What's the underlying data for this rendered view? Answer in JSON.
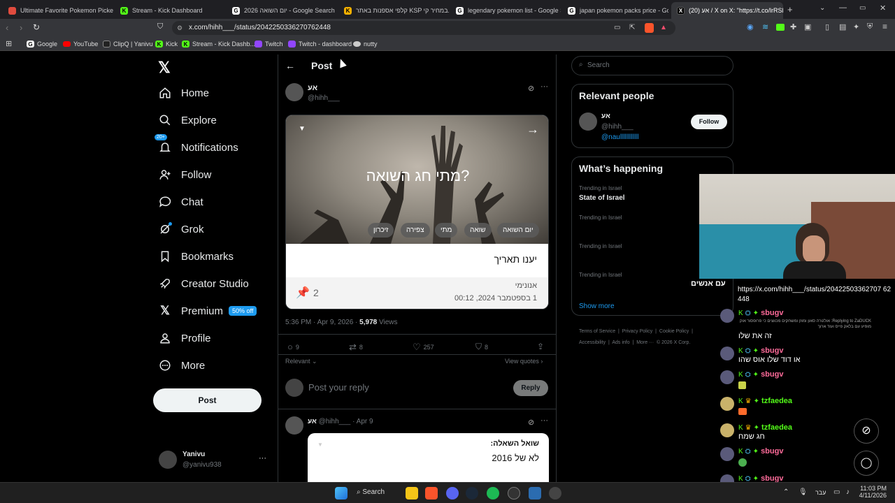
{
  "tabs": [
    {
      "label": "Ultimate Favorite Pokemon Picker",
      "fav": "#e04b3e"
    },
    {
      "label": "Stream - Kick Dashboard",
      "fav": "#53fc18"
    },
    {
      "label": "יום השואה 2026 - Google Search",
      "fav": "#ffffff"
    },
    {
      "label": "קלפי אספנות באתר KSP במחיר קי...",
      "fav": "#f5b000"
    },
    {
      "label": "legendary pokemon list - Google Se...",
      "fav": "#ffffff"
    },
    {
      "label": "japan pokemon packs price - Goog...",
      "fav": "#ffffff"
    },
    {
      "label": "(20) אע / X on X: \"https://t.co/lrRSDOHtIO\"",
      "fav": "#000000"
    }
  ],
  "url": "x.com/hihh___/status/2042250336270762448",
  "bookmarks": [
    "Google",
    "YouTube",
    "ClipQ | Yanivu",
    "Kick",
    "Stream - Kick Dashb...",
    "Twitch",
    "Twitch - dashboard",
    "nutty"
  ],
  "nav": {
    "items": [
      {
        "label": "Home",
        "icon": "home-icon"
      },
      {
        "label": "Explore",
        "icon": "search-icon"
      },
      {
        "label": "Notifications",
        "icon": "bell-icon"
      },
      {
        "label": "Follow",
        "icon": "add-person-icon"
      },
      {
        "label": "Chat",
        "icon": "chat-icon"
      },
      {
        "label": "Grok",
        "icon": "grok-icon"
      },
      {
        "label": "Bookmarks",
        "icon": "bookmark-icon"
      },
      {
        "label": "Creator Studio",
        "icon": "rocket-icon"
      },
      {
        "label": "Premium",
        "icon": "x-icon"
      },
      {
        "label": "Profile",
        "icon": "person-icon"
      },
      {
        "label": "More",
        "icon": "more-circle-icon"
      }
    ],
    "notif_badge": "20+",
    "premium_badge": "50% off",
    "post_button": "Post",
    "user_name": "Yanivu",
    "user_handle": "@yanivu938"
  },
  "main": {
    "header": "Post",
    "author_name": "אע",
    "author_handle": "@hihh___",
    "card_title": "מתי חג השואה?",
    "card_tags": [
      "יום השואה",
      "שואה",
      "מתי",
      "צפירה",
      "זיכרון"
    ],
    "card_answer": "יענו תאריך",
    "card_user": "אנונימי",
    "card_date": "1 בספטמבר 2024, 00:12",
    "card_pin_count": "2",
    "meta_time": "5:36 PM · Apr 9, 2026 · ",
    "meta_views_num": "5,978",
    "meta_views_label": " Views",
    "actions": {
      "replies": "9",
      "reposts": "8",
      "likes": "257",
      "bookmarks": "8"
    },
    "sort_label": "Relevant",
    "view_quotes": "View quotes",
    "reply_placeholder": "Post your reply",
    "reply_button": "Reply",
    "reply2_name": "אע",
    "reply2_handle": "@hihh___ · Apr 9",
    "reply2_card_q": "שואל השאלה:",
    "reply2_card_a": "לא של 2016"
  },
  "right": {
    "search_placeholder": "Search",
    "relevant_title": "Relevant people",
    "rp_name": "אע",
    "rp_handle": "@hihh___",
    "rp_bio": "@naullllllllllll",
    "follow_button": "Follow",
    "happening_title": "What’s happening",
    "trends": [
      {
        "context": "Trending in Israel",
        "title": "State of Israel"
      },
      {
        "context": "Trending in Israel",
        "title": ""
      },
      {
        "context": "Trending in Israel",
        "title": ""
      },
      {
        "context": "Trending in Israel",
        "title": ""
      }
    ],
    "trend_overlay": "עם אנשים",
    "show_more": "Show more",
    "footer1": "Terms of Service  |  Privacy Policy  |  Cookie Policy  |",
    "footer2": "Accessibility  |  Ads info  |  More ···  © 2026 X Corp."
  },
  "chat": {
    "link": "https://x.com/hihh___/status/20422503362707 62448",
    "messages": [
      {
        "user": "sbugv",
        "color": "#ff6b9a",
        "text": "זה את שלו",
        "sub": "Replying to ZaDUCK: אולטרה סאון ומוזן ומשחקים מכווצים כי פרופסור אוק מופיע עם בלאק פייס ועוד ארוך"
      },
      {
        "user": "sbugv",
        "color": "#ff6b9a",
        "text": "או דוד שלו אוס שהו",
        "sub": ""
      },
      {
        "user": "sbugv",
        "color": "#ff6b9a",
        "text": "",
        "sub": ""
      },
      {
        "user": "tzfaedea",
        "color": "#53fc18",
        "text": "",
        "sub": ""
      },
      {
        "user": "tzfaedea",
        "color": "#53fc18",
        "text": "חג שמח",
        "sub": ""
      },
      {
        "user": "sbugv",
        "color": "#ff6b9a",
        "text": "",
        "sub": ""
      },
      {
        "user": "sbugv",
        "color": "#ff6b9a",
        "text": "",
        "sub": ""
      }
    ]
  },
  "taskbar": {
    "search": "Search",
    "lang": "עבר",
    "time": "11:03 PM",
    "date": "4/11/2026"
  }
}
